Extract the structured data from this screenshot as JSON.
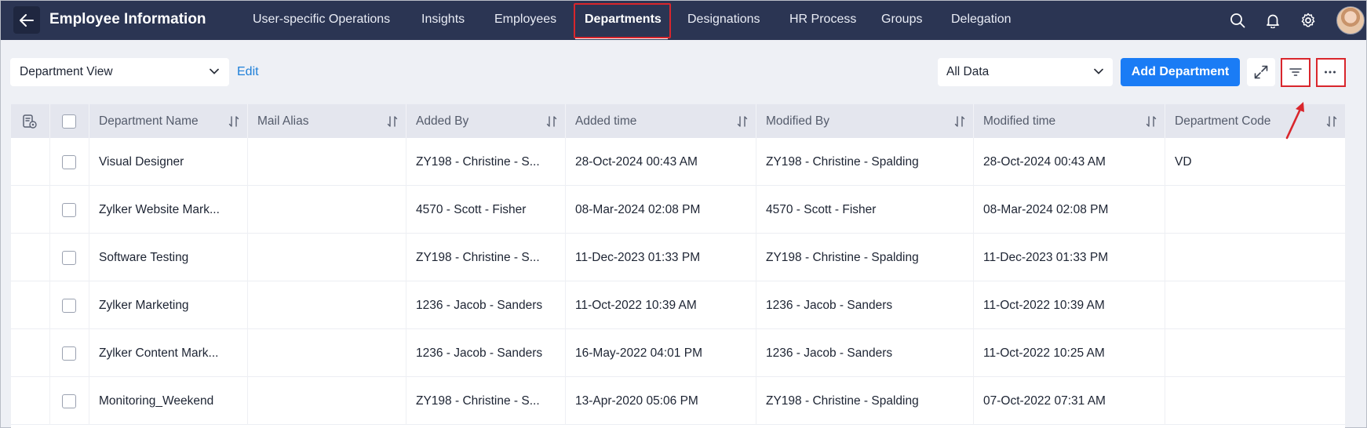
{
  "header": {
    "title": "Employee Information",
    "nav": [
      {
        "label": "User-specific Operations",
        "active": false
      },
      {
        "label": "Insights",
        "active": false
      },
      {
        "label": "Employees",
        "active": false
      },
      {
        "label": "Departments",
        "active": true
      },
      {
        "label": "Designations",
        "active": false
      },
      {
        "label": "HR Process",
        "active": false
      },
      {
        "label": "Groups",
        "active": false
      },
      {
        "label": "Delegation",
        "active": false
      }
    ],
    "icons": [
      "search-icon",
      "bell-icon",
      "gear-icon",
      "avatar"
    ]
  },
  "toolbar": {
    "view_select": "Department View",
    "edit_label": "Edit",
    "data_select": "All Data",
    "add_label": "Add Department"
  },
  "table": {
    "columns": [
      "Department Name",
      "Mail Alias",
      "Added By",
      "Added time",
      "Modified By",
      "Modified time",
      "Department Code"
    ],
    "rows": [
      [
        "Visual Designer",
        "",
        "ZY198 - Christine - S...",
        "28-Oct-2024 00:43 AM",
        "ZY198 - Christine - Spalding",
        "28-Oct-2024 00:43 AM",
        "VD"
      ],
      [
        "Zylker Website Mark...",
        "",
        "4570 - Scott - Fisher",
        "08-Mar-2024 02:08 PM",
        "4570 - Scott - Fisher",
        "08-Mar-2024 02:08 PM",
        ""
      ],
      [
        "Software Testing",
        "",
        "ZY198 - Christine - S...",
        "11-Dec-2023 01:33 PM",
        "ZY198 - Christine - Spalding",
        "11-Dec-2023 01:33 PM",
        ""
      ],
      [
        "Zylker Marketing",
        "",
        "1236 - Jacob - Sanders",
        "11-Oct-2022 10:39 AM",
        "1236 - Jacob - Sanders",
        "11-Oct-2022 10:39 AM",
        ""
      ],
      [
        "Zylker Content Mark...",
        "",
        "1236 - Jacob - Sanders",
        "16-May-2022 04:01 PM",
        "1236 - Jacob - Sanders",
        "11-Oct-2022 10:25 AM",
        ""
      ],
      [
        "Monitoring_Weekend",
        "",
        "ZY198 - Christine - S...",
        "13-Apr-2020 05:06 PM",
        "ZY198 - Christine - Spalding",
        "07-Oct-2022 07:31 AM",
        ""
      ]
    ]
  },
  "colors": {
    "header_bg": "#2b3553",
    "accent": "#1a7cf5",
    "highlight": "#d9262c"
  }
}
